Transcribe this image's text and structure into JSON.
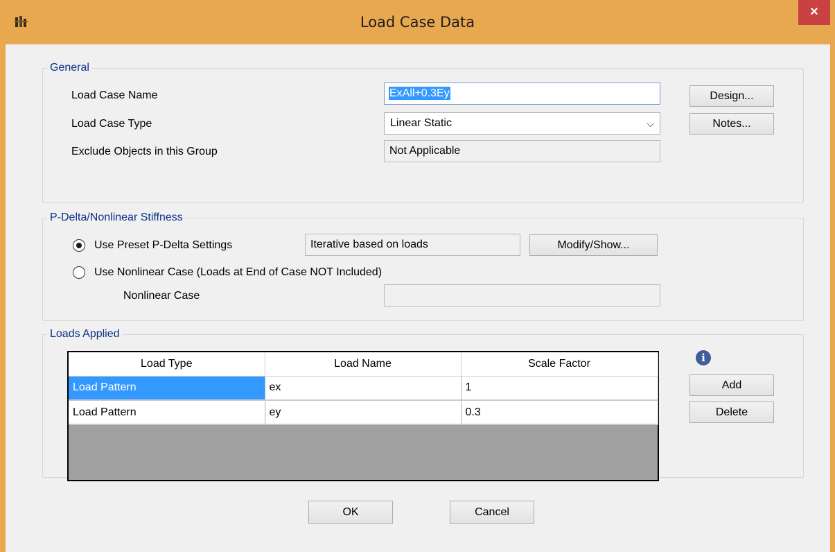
{
  "window": {
    "title": "Load Case Data",
    "close_glyph": "×",
    "app_icon": "etabs-app-icon"
  },
  "general": {
    "title": "General",
    "load_case_name_label": "Load Case Name",
    "load_case_name_value": "ExAll+0.3Ey",
    "load_case_type_label": "Load Case Type",
    "load_case_type_value": "Linear Static",
    "exclude_label": "Exclude Objects in this Group",
    "exclude_value": "Not Applicable",
    "design_button": "Design...",
    "notes_button": "Notes..."
  },
  "pdelta": {
    "title": "P-Delta/Nonlinear Stiffness",
    "preset_label": "Use Preset P-Delta Settings",
    "preset_value": "Iterative based on loads",
    "modify_button": "Modify/Show...",
    "nonlinear_label": "Use Nonlinear Case  (Loads at End of Case NOT Included)",
    "nonlinear_case_label": "Nonlinear Case",
    "nonlinear_case_value": ""
  },
  "loads": {
    "title": "Loads Applied",
    "columns": [
      "Load Type",
      "Load Name",
      "Scale Factor"
    ],
    "rows": [
      [
        "Load Pattern",
        "ex",
        "1"
      ],
      [
        "Load Pattern",
        "ey",
        "0.3"
      ]
    ],
    "add_button": "Add",
    "delete_button": "Delete",
    "info_glyph": "i"
  },
  "footer": {
    "ok_button": "OK",
    "cancel_button": "Cancel"
  },
  "colors": {
    "title_bar": "#e8a84f",
    "close_button": "#c74240",
    "group_title": "#0b2f8a",
    "selection": "#3399ff"
  }
}
